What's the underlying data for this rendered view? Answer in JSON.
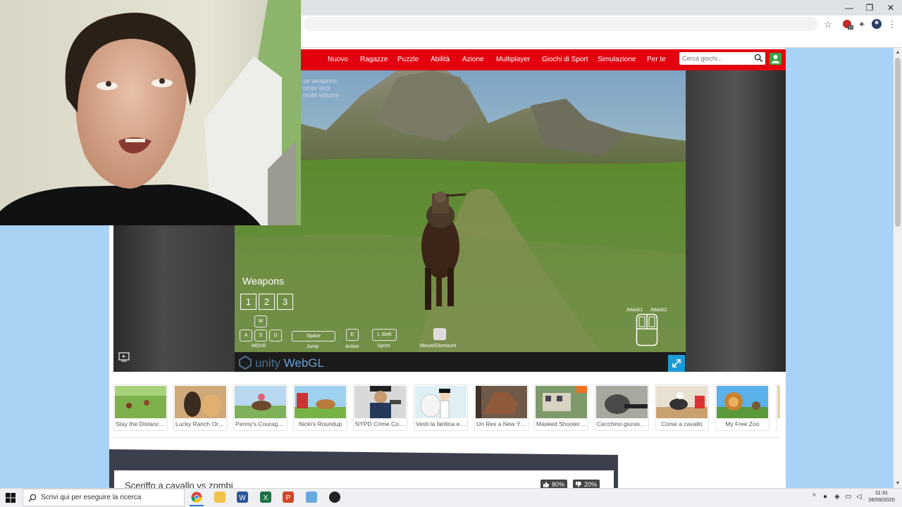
{
  "browser": {
    "controls": {
      "minimize": "—",
      "restore": "❐",
      "close": "✕"
    },
    "toolbar_icons": [
      "star-icon",
      "adblock-icon",
      "extensions-icon",
      "profile-icon",
      "menu-icon"
    ],
    "adblock_badge": "10"
  },
  "site": {
    "nav": [
      "Nuovo",
      "Ragazze",
      "Puzzle",
      "Abilità",
      "Azione",
      "Multiplayer",
      "Giochi di Sport",
      "Simulazione",
      "Per te"
    ],
    "search_placeholder": "Cerca giochi...",
    "accent_color": "#e3000f"
  },
  "game": {
    "overlay_help": [
      "se weapons",
      "ursor lock",
      "mute volume"
    ],
    "weapons_title": "Weapons",
    "weapon_slots": [
      "1",
      "2",
      "3"
    ],
    "keys": {
      "w": "W",
      "a": "A",
      "s": "S",
      "d": "D",
      "move": "MOVE",
      "space": "Space",
      "jump": "Jump",
      "e": "E",
      "action": "Action",
      "shift": "L Shift",
      "sprint": "Sprint",
      "mount": "Mount/Dismount",
      "attack1": "Attack1",
      "attack2": "Attack2"
    },
    "engine_text_a": "unity",
    "engine_text_b": "WebGL"
  },
  "thumbnails": [
    {
      "label": "Stay the Distance..."
    },
    {
      "label": "Lucky Ranch Ores..."
    },
    {
      "label": "Penny's Courageo..."
    },
    {
      "label": "Nicki's Roundup"
    },
    {
      "label": "NYPD Crime Cont..."
    },
    {
      "label": "Vesti la fantina e i..."
    },
    {
      "label": "Un Rex a New York"
    },
    {
      "label": "Masked Shooter ..."
    },
    {
      "label": "Cecchino giurassi..."
    },
    {
      "label": "Corse a cavallo"
    },
    {
      "label": "My Free Zoo"
    }
  ],
  "game_info": {
    "title": "Sceriffo a cavallo vs zombi",
    "likes": "80%",
    "dislikes": "20%"
  },
  "taskbar": {
    "search_placeholder": "Scrivi qui per eseguire la ricerca",
    "apps": [
      "chrome-icon",
      "file-explorer-icon",
      "word-icon",
      "excel-icon",
      "powerpoint-icon",
      "paint-icon",
      "obs-icon"
    ],
    "time": "11:31",
    "date": "26/09/2020"
  }
}
